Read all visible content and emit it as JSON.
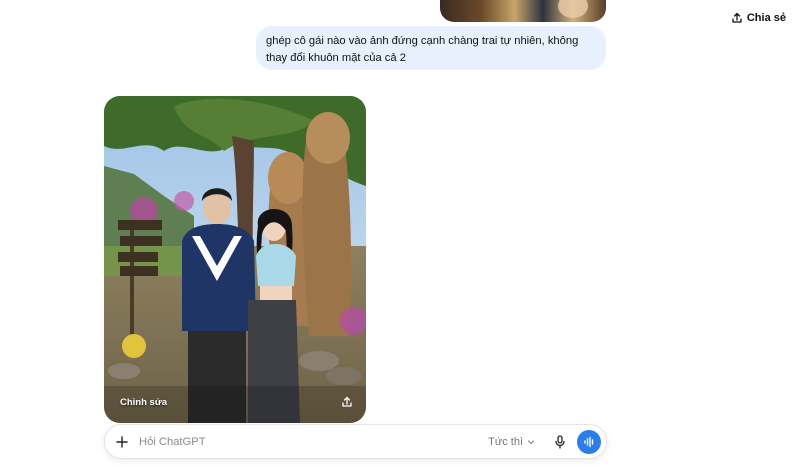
{
  "header": {
    "share_label": "Chia sẻ",
    "share_icon": "share-icon"
  },
  "conversation": {
    "user_message": "ghép cô gái nào vào ảnh đứng cạnh chàng trai tự nhiên, không thay đổi khuôn mặt của cả 2",
    "generated_image": {
      "edit_label": "Chỉnh sửa",
      "share_icon": "share-icon"
    }
  },
  "composer": {
    "placeholder": "Hỏi ChatGPT",
    "mode_label": "Tức thì",
    "plus_icon": "plus-icon",
    "mic_icon": "mic-icon",
    "voice_icon": "voice-waveform-icon"
  },
  "colors": {
    "accent": "#2b7de9",
    "user_bubble": "#e8f0fe"
  }
}
